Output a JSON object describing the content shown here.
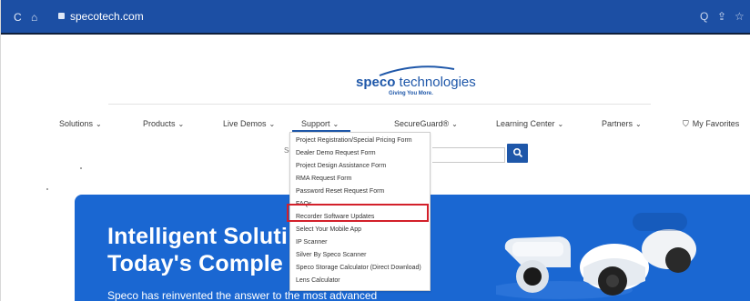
{
  "browser": {
    "reload_icon": "C",
    "home_icon": "⌂",
    "url": "specotech.com",
    "search_icon": "Q",
    "share_icon": "⇪",
    "star_icon": "☆"
  },
  "logo": {
    "brand": "speco",
    "brand_rest": " technologies",
    "tagline": "Giving You More."
  },
  "nav": {
    "items": [
      "Solutions",
      "Products",
      "Live Demos",
      "Support",
      "SecureGuard®",
      "Learning Center",
      "Partners"
    ],
    "chevron": "⌄",
    "favorites_icon": "⛉",
    "favorites": "My Favorites"
  },
  "search": {
    "placeholder_fragment": "Se",
    "button_icon": "magnifier"
  },
  "support_menu": {
    "items": [
      "Project Registration/Special Pricing Form",
      "Dealer Demo Request Form",
      "Project Design Assistance Form",
      "RMA Request Form",
      "Password Reset Request Form",
      "FAQs",
      "Recorder Software Updates",
      "Select Your Mobile App",
      "IP Scanner",
      "Silver By Speco Scanner",
      "Speco Storage Calculator (Direct Download)",
      "Lens Calculator"
    ],
    "highlighted_index": 6
  },
  "hero": {
    "line1": "Intelligent Soluti",
    "line2": "Today's Comple",
    "subtext": "Speco has reinvented the answer to the most advanced"
  },
  "colors": {
    "browser_bar": "#1c4fa4",
    "brand_blue": "#1e57a9",
    "hero_blue": "#1a67d2",
    "highlight_red": "#d3202a"
  }
}
